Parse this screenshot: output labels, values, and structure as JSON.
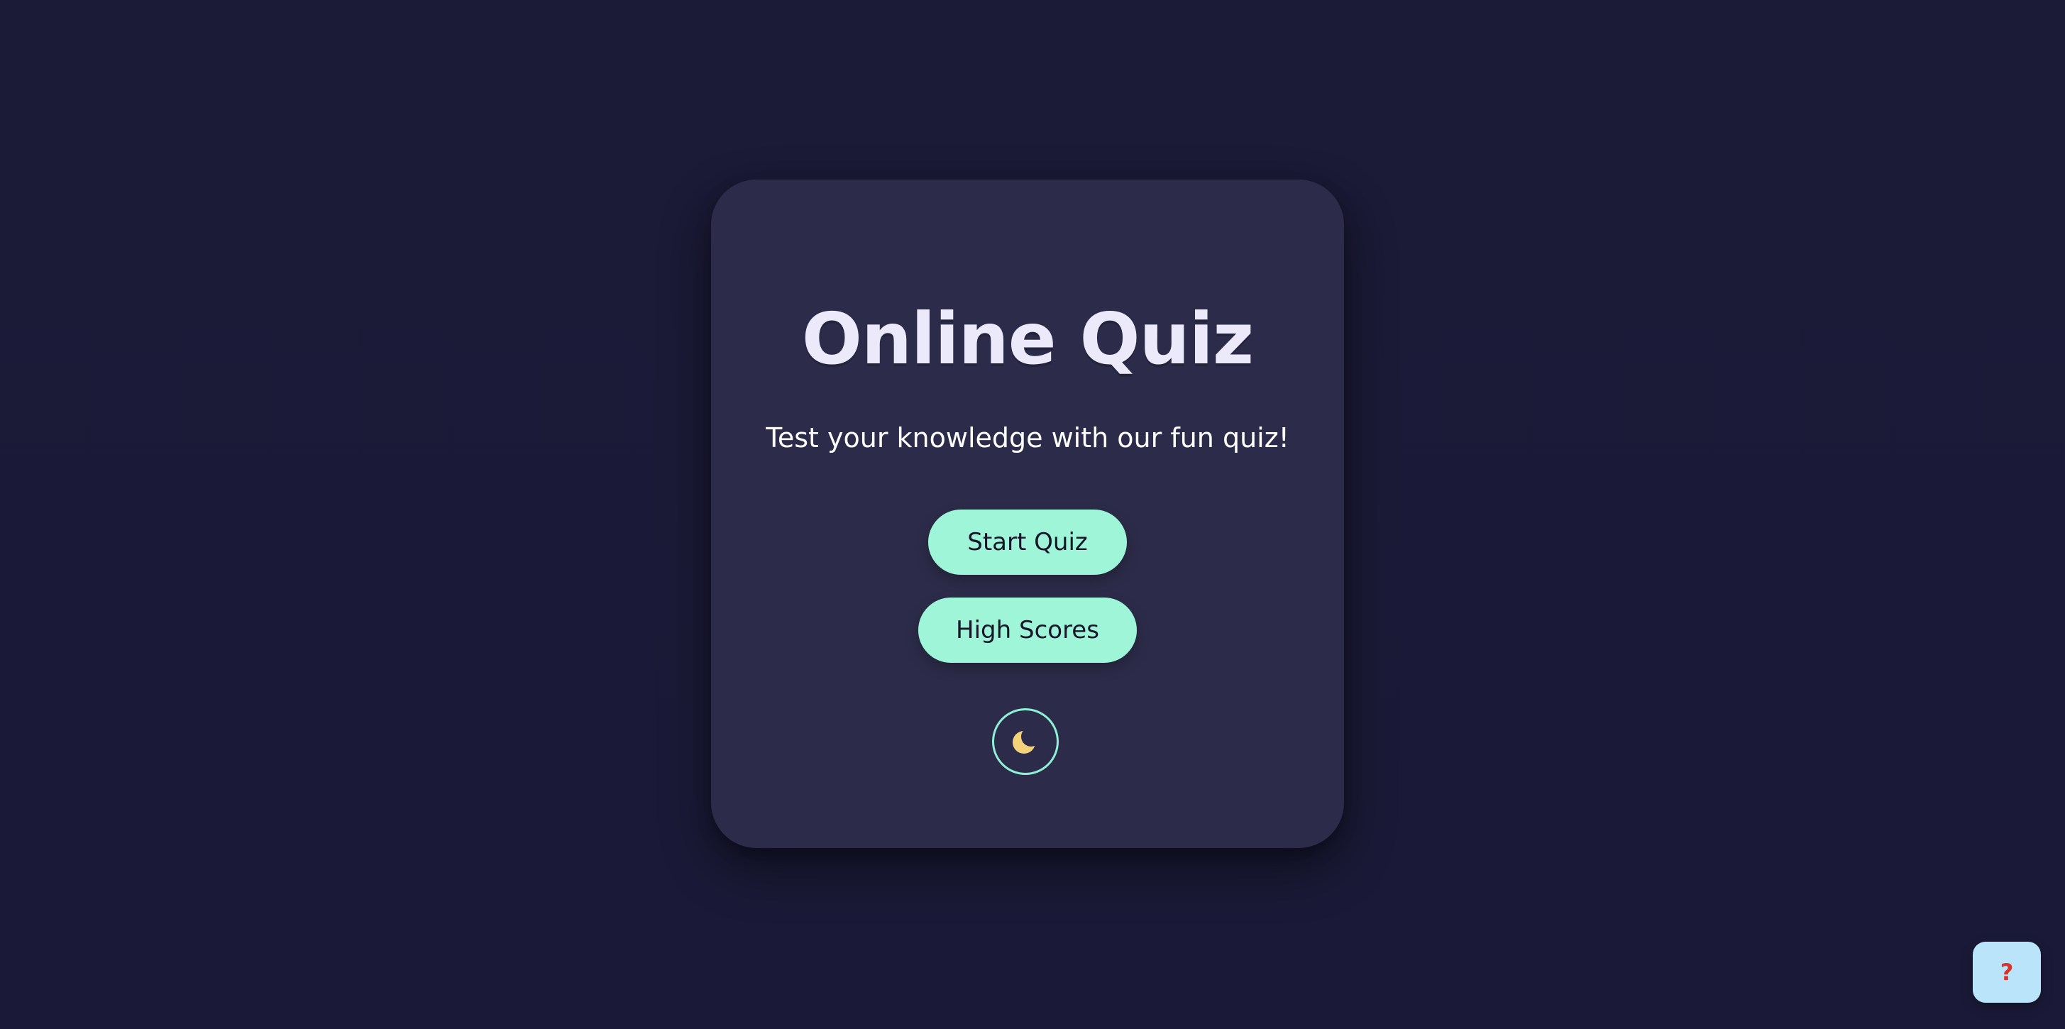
{
  "home": {
    "title": "Online Quiz",
    "subtitle": "Test your knowledge with our fun quiz!",
    "start_label": "Start Quiz",
    "scores_label": "High Scores",
    "theme_toggle_icon": "moon-icon"
  },
  "help": {
    "label": "?"
  },
  "colors": {
    "background": "#1b1a37",
    "card": "#2c2c4a",
    "button": "#9ef5d8",
    "toggle_border": "#8ef0d4",
    "moon": "#f4d27a",
    "help_bg": "#b9e4f9",
    "help_text": "#d9342b"
  }
}
